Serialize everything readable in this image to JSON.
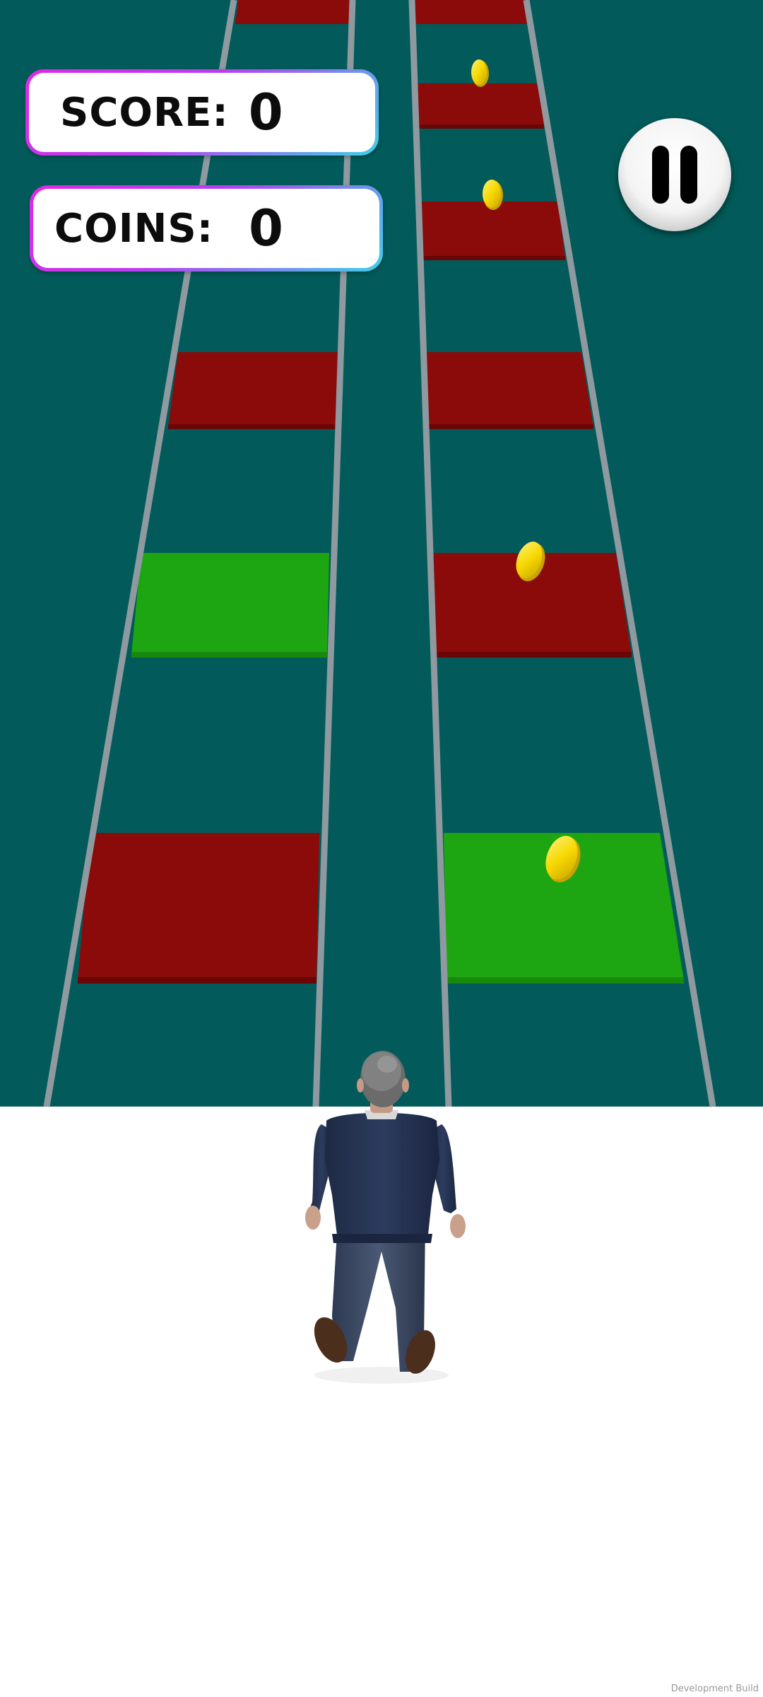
{
  "hud": {
    "score_label": "SCORE:",
    "score_value": "0",
    "coins_label": "COINS:",
    "coins_value": "0"
  },
  "pause_button": {
    "icon": "pause-icon"
  },
  "footer": {
    "watermark": "Development Build"
  },
  "colors": {
    "background": "#025b5a",
    "ground": "#ffffff",
    "rail": "#8e9aa0",
    "red_tile": "#8b0a0a",
    "green_tile": "#1ea512",
    "coin": "#f5d400",
    "hud_border_start": "#e028e6",
    "hud_border_end": "#3fd0e8"
  },
  "scene": {
    "tiles": [
      {
        "lane": "left",
        "color": "red"
      },
      {
        "lane": "right",
        "color": "red"
      },
      {
        "lane": "right",
        "color": "red"
      },
      {
        "lane": "right",
        "color": "red"
      },
      {
        "lane": "left",
        "color": "red"
      },
      {
        "lane": "right",
        "color": "red"
      },
      {
        "lane": "left",
        "color": "green"
      },
      {
        "lane": "right",
        "color": "red"
      },
      {
        "lane": "left",
        "color": "red"
      },
      {
        "lane": "right",
        "color": "green"
      }
    ],
    "coin_count_visible": 4
  }
}
